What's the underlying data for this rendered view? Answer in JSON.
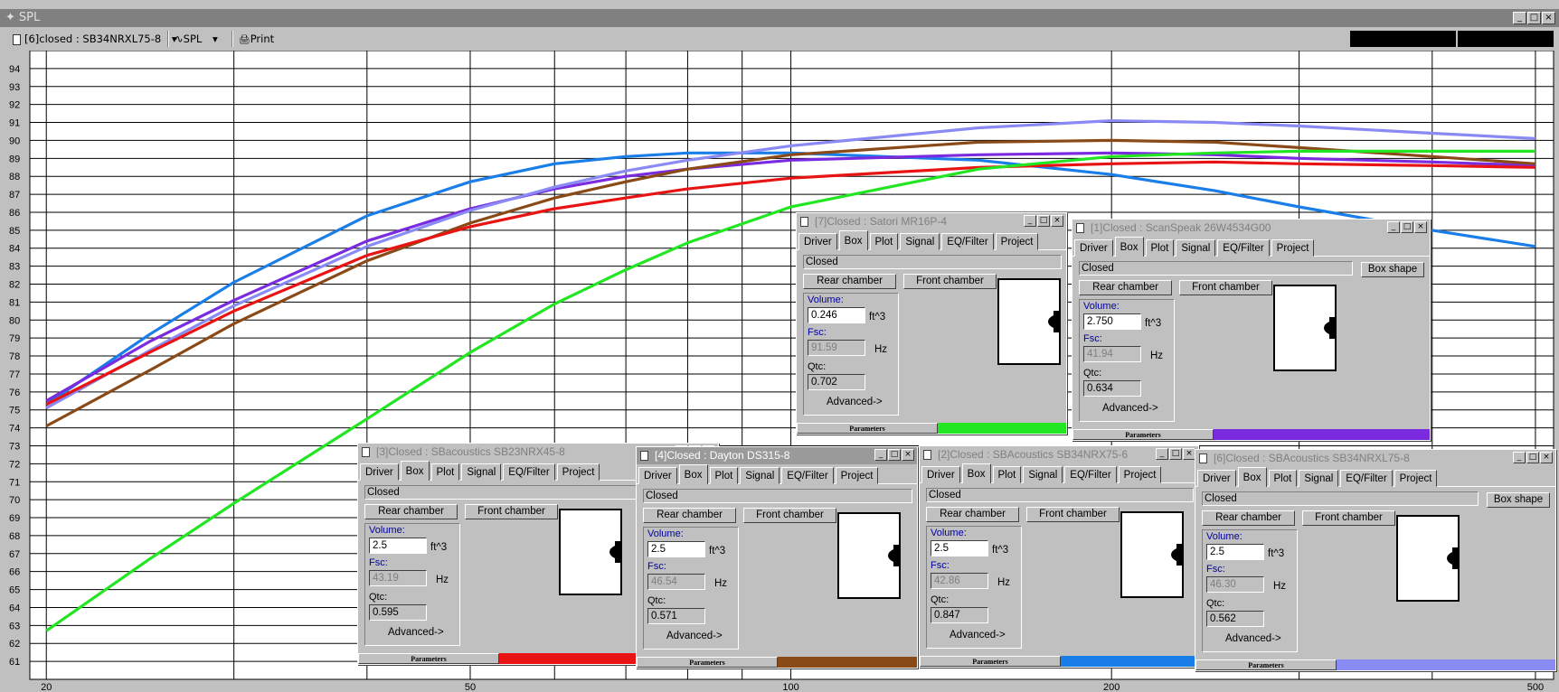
{
  "window": {
    "title": "SPL",
    "title_symbol": "✦",
    "min_symbol": "_",
    "max_symbol": "□",
    "close_symbol": "×"
  },
  "toolbar": {
    "project_select": "[6]closed : SB34NRXL75-8",
    "dropdown_arrow": "▾",
    "plot_select": "SPL",
    "plot_icon": "∿",
    "print_label": "Print",
    "print_icon": "🖨"
  },
  "chart_data": {
    "type": "line",
    "xscale": "log",
    "xlim": [
      19.3,
      520
    ],
    "ylim": [
      60,
      95
    ],
    "yticks": [
      61,
      62,
      63,
      64,
      65,
      66,
      67,
      68,
      69,
      70,
      71,
      72,
      73,
      74,
      75,
      76,
      77,
      78,
      79,
      80,
      81,
      82,
      83,
      84,
      85,
      86,
      87,
      88,
      89,
      90,
      91,
      92,
      93,
      94
    ],
    "xticks": [
      20,
      50,
      100,
      200,
      500
    ],
    "xgrid": [
      20,
      30,
      40,
      50,
      60,
      70,
      80,
      90,
      100,
      200,
      300,
      400,
      500
    ],
    "grid": true,
    "series": [
      {
        "color": "#1a7ee8",
        "x": [
          20,
          25,
          30,
          40,
          50,
          60,
          70,
          80,
          100,
          150,
          200,
          250,
          300,
          400,
          500
        ],
        "y": [
          75.3,
          79.2,
          82.1,
          85.8,
          87.7,
          88.7,
          89.1,
          89.3,
          89.3,
          88.9,
          88.1,
          87.2,
          86.3,
          85.0,
          84.1
        ]
      },
      {
        "color": "#7a2be0",
        "x": [
          20,
          25,
          30,
          40,
          50,
          60,
          70,
          80,
          100,
          150,
          200,
          250,
          300,
          400,
          500
        ],
        "y": [
          75.5,
          78.8,
          81.1,
          84.4,
          86.2,
          87.3,
          88.0,
          88.4,
          88.9,
          89.2,
          89.3,
          89.2,
          89.0,
          88.8,
          88.6
        ]
      },
      {
        "color": "#8a8af5",
        "x": [
          20,
          25,
          30,
          40,
          50,
          60,
          70,
          80,
          100,
          150,
          200,
          250,
          300,
          400,
          500
        ],
        "y": [
          75.1,
          78.3,
          80.8,
          84.1,
          86.1,
          87.4,
          88.3,
          88.9,
          89.7,
          90.7,
          91.1,
          91.0,
          90.8,
          90.4,
          90.1
        ]
      },
      {
        "color": "#8a4a18",
        "x": [
          20,
          25,
          30,
          40,
          50,
          60,
          70,
          80,
          100,
          150,
          200,
          250,
          300,
          400,
          500
        ],
        "y": [
          74.1,
          77.2,
          79.8,
          83.3,
          85.4,
          86.8,
          87.7,
          88.4,
          89.2,
          89.9,
          90.0,
          89.9,
          89.6,
          89.1,
          88.7
        ]
      },
      {
        "color": "#e81414",
        "x": [
          20,
          25,
          30,
          40,
          50,
          60,
          70,
          80,
          100,
          150,
          200,
          250,
          300,
          400,
          500
        ],
        "y": [
          75.3,
          78.2,
          80.5,
          83.6,
          85.2,
          86.2,
          86.8,
          87.3,
          87.9,
          88.5,
          88.7,
          88.8,
          88.7,
          88.6,
          88.5
        ]
      },
      {
        "color": "#22e622",
        "x": [
          20,
          25,
          30,
          40,
          50,
          60,
          70,
          80,
          100,
          150,
          200,
          250,
          300,
          400,
          500
        ],
        "y": [
          62.7,
          66.7,
          69.8,
          74.5,
          78.2,
          80.9,
          82.8,
          84.3,
          86.3,
          88.4,
          89.1,
          89.3,
          89.4,
          89.4,
          89.4
        ]
      }
    ]
  },
  "box_panel": {
    "tabs": [
      "Driver",
      "Box",
      "Plot",
      "Signal",
      "EQ/Filter",
      "Project"
    ],
    "closed_label": "Closed",
    "rear_chamber": "Rear chamber",
    "front_chamber": "Front chamber",
    "box_shape": "Box shape",
    "volume_label": "Volume:",
    "fsc_label": "Fsc:",
    "qtc_label": "Qtc:",
    "volume_unit": "ft^3",
    "fsc_unit": "Hz",
    "advanced": "Advanced->",
    "parameters": "Parameters"
  },
  "panels": [
    {
      "title": "[7]Closed : Satori MR16P-4",
      "volume": "0.246",
      "fsc": "91.59",
      "qtc": "0.702",
      "color": "#22e622",
      "active": false
    },
    {
      "title": "[1]Closed : ScanSpeak 26W4534G00",
      "volume": "2.750",
      "fsc": "41.94",
      "qtc": "0.634",
      "color": "#7a2be0",
      "active": false
    },
    {
      "title": "[3]Closed : SBacoustics SB23NRX45-8",
      "volume": "2.5",
      "fsc": "43.19",
      "qtc": "0.595",
      "color": "#e81414",
      "active": false
    },
    {
      "title": "[4]Closed : Dayton DS315-8",
      "volume": "2.5",
      "fsc": "46.54",
      "qtc": "0.571",
      "color": "#8a4a18",
      "active": true
    },
    {
      "title": "[2]Closed : SBAcoustics SB34NRX75-6",
      "volume": "2.5",
      "fsc": "42.86",
      "qtc": "0.847",
      "color": "#1a7ee8",
      "active": false
    },
    {
      "title": "[6]Closed : SBAcoustics SB34NRXL75-8",
      "volume": "2.5",
      "fsc": "46.30",
      "qtc": "0.562",
      "color": "#8a8af5",
      "active": false
    }
  ]
}
